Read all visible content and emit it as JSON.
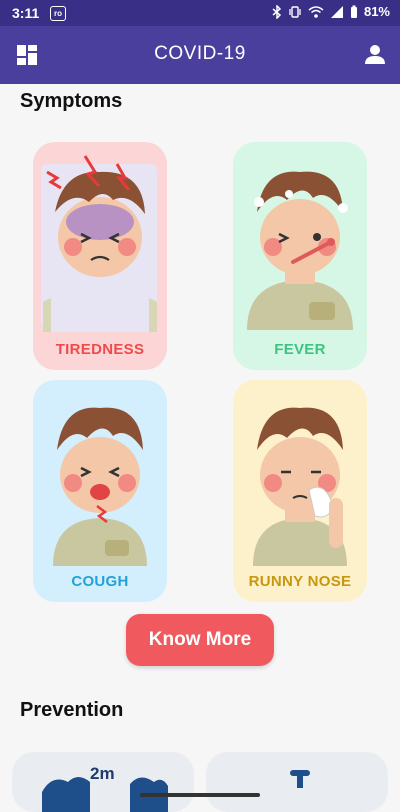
{
  "status_bar": {
    "time": "3:11",
    "notification_badge": "ro",
    "battery": "81%"
  },
  "app_bar": {
    "title": "COVID-19",
    "menu_icon": "dashboard-icon",
    "user_icon": "account-icon"
  },
  "symptoms": {
    "heading": "Symptoms",
    "cards": [
      {
        "label": "TIREDNESS",
        "bg": "#fcd6d6",
        "color": "#ef4b4b"
      },
      {
        "label": "FEVER",
        "bg": "#d7f7e6",
        "color": "#3cc483"
      },
      {
        "label": "COUGH",
        "bg": "#d3effd",
        "color": "#22a2d8"
      },
      {
        "label": "RUNNY NOSE",
        "bg": "#fdf1cc",
        "color": "#c8970c"
      }
    ],
    "button_label": "Know More",
    "button_color": "#f05a5f"
  },
  "prevention": {
    "heading": "Prevention",
    "distance_label": "2m"
  },
  "colors": {
    "accent": "#4b3f9e",
    "status": "#3a2f86"
  }
}
